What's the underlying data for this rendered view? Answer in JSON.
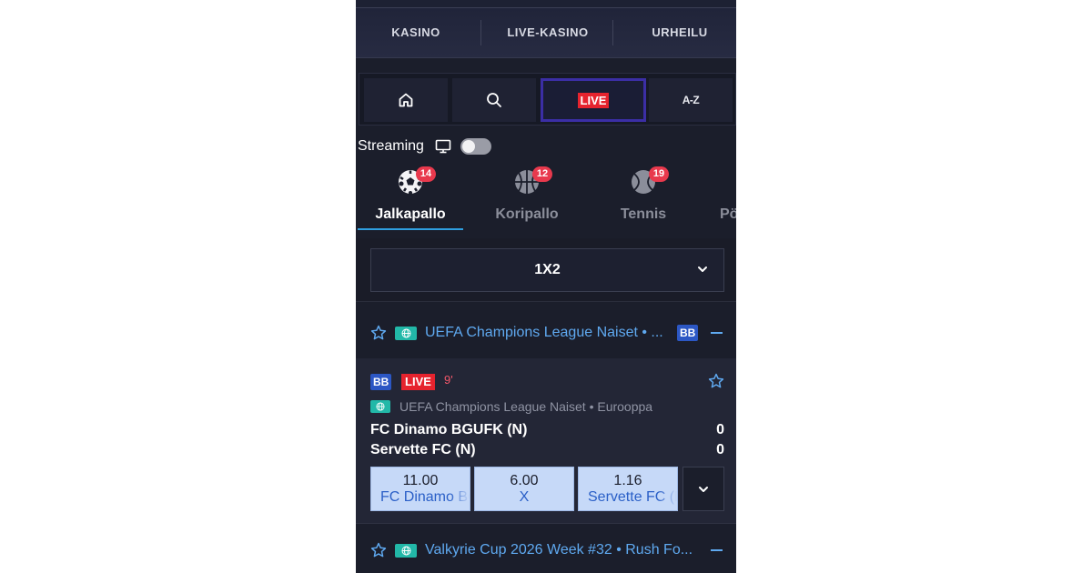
{
  "topnav": {
    "tabs": [
      {
        "label": "KASINO"
      },
      {
        "label": "LIVE-KASINO"
      },
      {
        "label": "URHEILU"
      }
    ]
  },
  "toolbar": {
    "home_icon": "home-icon",
    "search_icon": "search-icon",
    "live_label": "LIVE",
    "az_label": "A-Z"
  },
  "streaming": {
    "label": "Streaming",
    "icon": "monitor-icon",
    "enabled": false
  },
  "sports": [
    {
      "name": "Jalkapallo",
      "count": "14",
      "icon": "soccer-ball-icon",
      "active": true
    },
    {
      "name": "Koripallo",
      "count": "12",
      "icon": "basketball-icon",
      "active": false
    },
    {
      "name": "Tennis",
      "count": "19",
      "icon": "tennis-ball-icon",
      "active": false
    },
    {
      "name": "Pö",
      "count": "",
      "icon": "",
      "active": false
    }
  ],
  "market": {
    "selected": "1X2"
  },
  "leagues": [
    {
      "name": "UEFA Champions League Naiset • ...",
      "badge": "BB"
    },
    {
      "name": "Valkyrie Cup 2026 Week #32 • Rush Fo..."
    }
  ],
  "event": {
    "badge": "BB",
    "live_label": "LIVE",
    "minute": "9'",
    "league": "UEFA Champions League Naiset • Eurooppa",
    "home_team": "FC Dinamo BGUFK (N)",
    "away_team": "Servette FC (N)",
    "home_score": "0",
    "away_score": "0",
    "odds": [
      {
        "value": "11.00",
        "label": "FC Dinamo BGUFK (N)"
      },
      {
        "value": "6.00",
        "label": "X"
      },
      {
        "value": "1.16",
        "label": "Servette FC (N)"
      }
    ]
  },
  "colors": {
    "background": "#1b1e2b",
    "live_red": "#e6232e",
    "link_blue": "#5fa9f0",
    "badge_red": "#e8394d",
    "odds_bg": "#c6d9f8"
  }
}
